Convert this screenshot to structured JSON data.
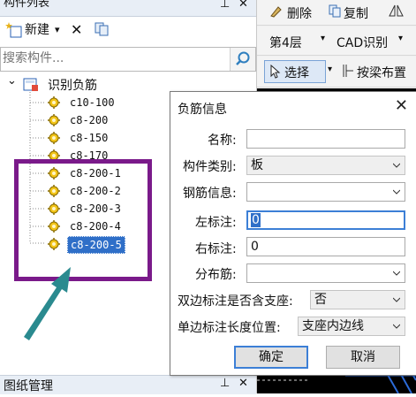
{
  "left_panel": {
    "title": "构件列表",
    "pin_glyph": "⊥",
    "close_glyph": "✕",
    "toolbar": {
      "new_label": "新建",
      "new_dropdown_glyph": "▾",
      "delete_glyph": "✕",
      "copy_icon": "copy-icon"
    },
    "search": {
      "placeholder": "搜索构件..."
    },
    "tree": {
      "root_label": "识别负筋",
      "expand_glyph": "⌄",
      "items": [
        "c10-100",
        "c8-200",
        "c8-150",
        "c8-170",
        "c8-200-1",
        "c8-200-2",
        "c8-200-3",
        "c8-200-4",
        "c8-200-5"
      ],
      "selected_index": 8
    },
    "bottom_title": "图纸管理",
    "bottom_pin": "⊥",
    "bottom_close": "✕"
  },
  "right_strip": {
    "row1": {
      "delete": "删除",
      "copy": "复制"
    },
    "row2": {
      "floor": "第4层",
      "cad": "CAD识别"
    },
    "row3": {
      "select": "选择",
      "beam": "按梁布置"
    }
  },
  "dialog": {
    "title": "负筋信息",
    "close_glyph": "✕",
    "fields": {
      "name_label": "名称:",
      "name_value": "",
      "type_label": "构件类别:",
      "type_value": "板",
      "rebar_label": "钢筋信息:",
      "rebar_value": "",
      "left_label": "左标注:",
      "left_value": "0",
      "right_label": "右标注:",
      "right_value": "0",
      "dist_label": "分布筋:",
      "dist_value": "",
      "double_label": "双边标注是否含支座:",
      "double_value": "否",
      "single_label": "单边标注长度位置:",
      "single_value": "支座内边线"
    },
    "ok_label": "确定",
    "cancel_label": "取消"
  },
  "colors": {
    "annotation_box": "#7a1a8a",
    "annotation_arrow": "#2a8a8f",
    "selection": "#2f6fc8",
    "focus_border": "#3c7fd6"
  }
}
